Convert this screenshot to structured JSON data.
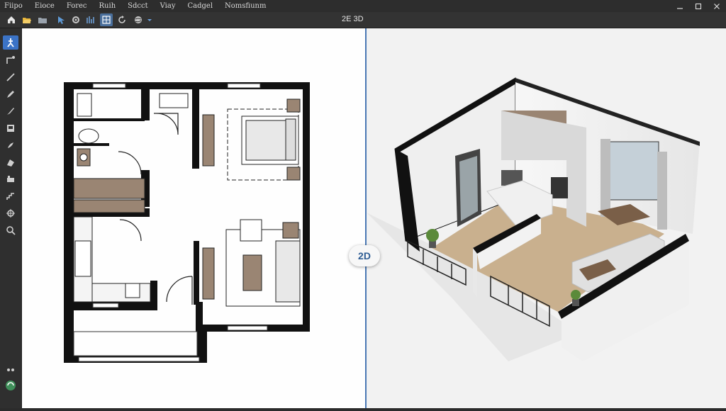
{
  "menu": [
    "Fiipo",
    "Eioce",
    "Forec",
    "Ruih",
    "Sdcct",
    "Viay",
    "Cadgel",
    "Nomsfiunm"
  ],
  "view_label": "2E 3D",
  "overlay_badge": "2D",
  "icons": {
    "toolbar": [
      "home-icon",
      "open-folder-icon",
      "folder-icon",
      "pointer-icon",
      "settings-icon",
      "snap-icon",
      "grid-icon",
      "rotate-icon",
      "globe-icon",
      "dropdown-icon"
    ],
    "left_toolbar": [
      "select-icon",
      "wall-tool-icon",
      "line-tool-icon",
      "pencil-icon",
      "brush-icon",
      "door-icon",
      "paint-icon",
      "measure-icon",
      "furniture-icon",
      "stairs-icon",
      "pan-icon",
      "zoom-icon",
      "layers-icon",
      "camera-icon"
    ]
  },
  "colors": {
    "accent": "#3b73c6",
    "divider": "#4a78b4",
    "wall": "#111111",
    "wood_floor": "#c9b08e",
    "cabinet": "#9a8573"
  }
}
